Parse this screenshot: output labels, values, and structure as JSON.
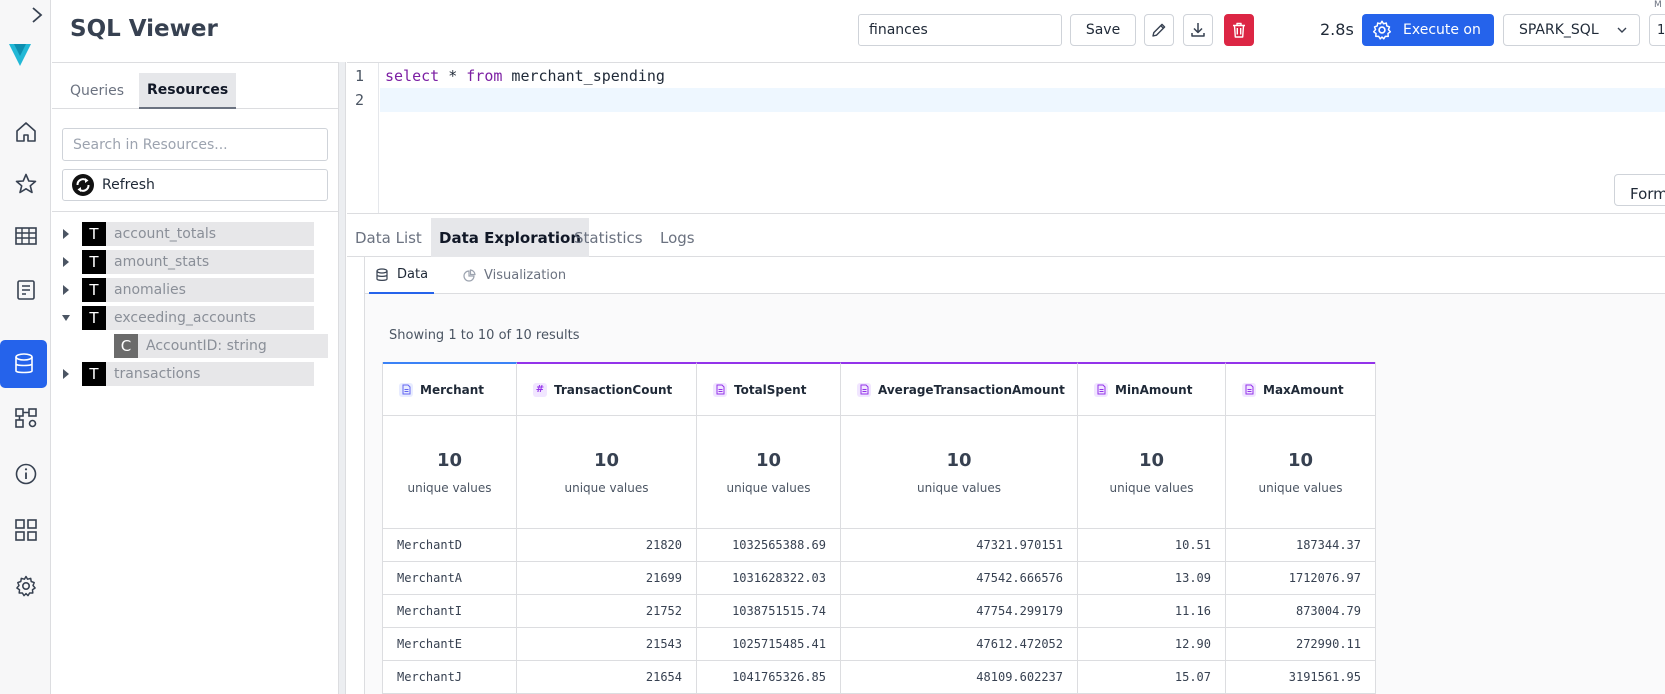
{
  "header": {
    "title": "SQL Viewer",
    "query_name": "finances",
    "save_label": "Save",
    "elapsed": "2.8s",
    "execute_label": "Execute on",
    "engine": "SPARK_SQL",
    "limit_value": "1",
    "limit_label": "M"
  },
  "colors": {
    "primary": "#2563eb",
    "danger": "#dc2644",
    "column_accent": "#9333ea"
  },
  "panel": {
    "tabs": [
      {
        "label": "Queries",
        "active": false
      },
      {
        "label": "Resources",
        "active": true
      }
    ],
    "search_placeholder": "Search in Resources...",
    "refresh_label": "Refresh",
    "tree": [
      {
        "badge": "T",
        "label": "account_totals",
        "expanded": false
      },
      {
        "badge": "T",
        "label": "amount_stats",
        "expanded": false
      },
      {
        "badge": "T",
        "label": "anomalies",
        "expanded": false
      },
      {
        "badge": "T",
        "label": "exceeding_accounts",
        "expanded": true
      },
      {
        "badge": "C",
        "label": "AccountID: string",
        "child": true
      },
      {
        "badge": "T",
        "label": "transactions",
        "expanded": false
      }
    ]
  },
  "editor": {
    "lines": [
      {
        "num": "1",
        "kw1": "select",
        "mid": " * ",
        "kw2": "from",
        "rest": " merchant_spending"
      },
      {
        "num": "2"
      }
    ],
    "format_label": "Form"
  },
  "result_tabs": [
    {
      "label": "Data List",
      "active": false
    },
    {
      "label": "Data Exploration",
      "active": true
    },
    {
      "label": "Statistics",
      "active": false
    },
    {
      "label": "Logs",
      "active": false
    }
  ],
  "sub_tabs": [
    {
      "label": "Data",
      "icon": "database-icon",
      "active": true
    },
    {
      "label": "Visualization",
      "icon": "chart-pie-icon",
      "active": false
    }
  ],
  "results": {
    "showing": "Showing 1 to 10 of 10 results",
    "columns": [
      {
        "name": "Merchant",
        "type": "string",
        "unique": "10"
      },
      {
        "name": "TransactionCount",
        "type": "number",
        "unique": "10"
      },
      {
        "name": "TotalSpent",
        "type": "document",
        "unique": "10"
      },
      {
        "name": "AverageTransactionAmount",
        "type": "document",
        "unique": "10"
      },
      {
        "name": "MinAmount",
        "type": "document",
        "unique": "10"
      },
      {
        "name": "MaxAmount",
        "type": "document",
        "unique": "10"
      }
    ],
    "unique_label": "unique values",
    "rows": [
      [
        "MerchantD",
        "21820",
        "1032565388.69",
        "47321.970151",
        "10.51",
        "187344.37"
      ],
      [
        "MerchantA",
        "21699",
        "1031628322.03",
        "47542.666576",
        "13.09",
        "1712076.97"
      ],
      [
        "MerchantI",
        "21752",
        "1038751515.74",
        "47754.299179",
        "11.16",
        "873004.79"
      ],
      [
        "MerchantE",
        "21543",
        "1025715485.41",
        "47612.472052",
        "12.90",
        "272990.11"
      ],
      [
        "MerchantJ",
        "21654",
        "1041765326.85",
        "48109.602237",
        "15.07",
        "3191561.95"
      ]
    ]
  }
}
